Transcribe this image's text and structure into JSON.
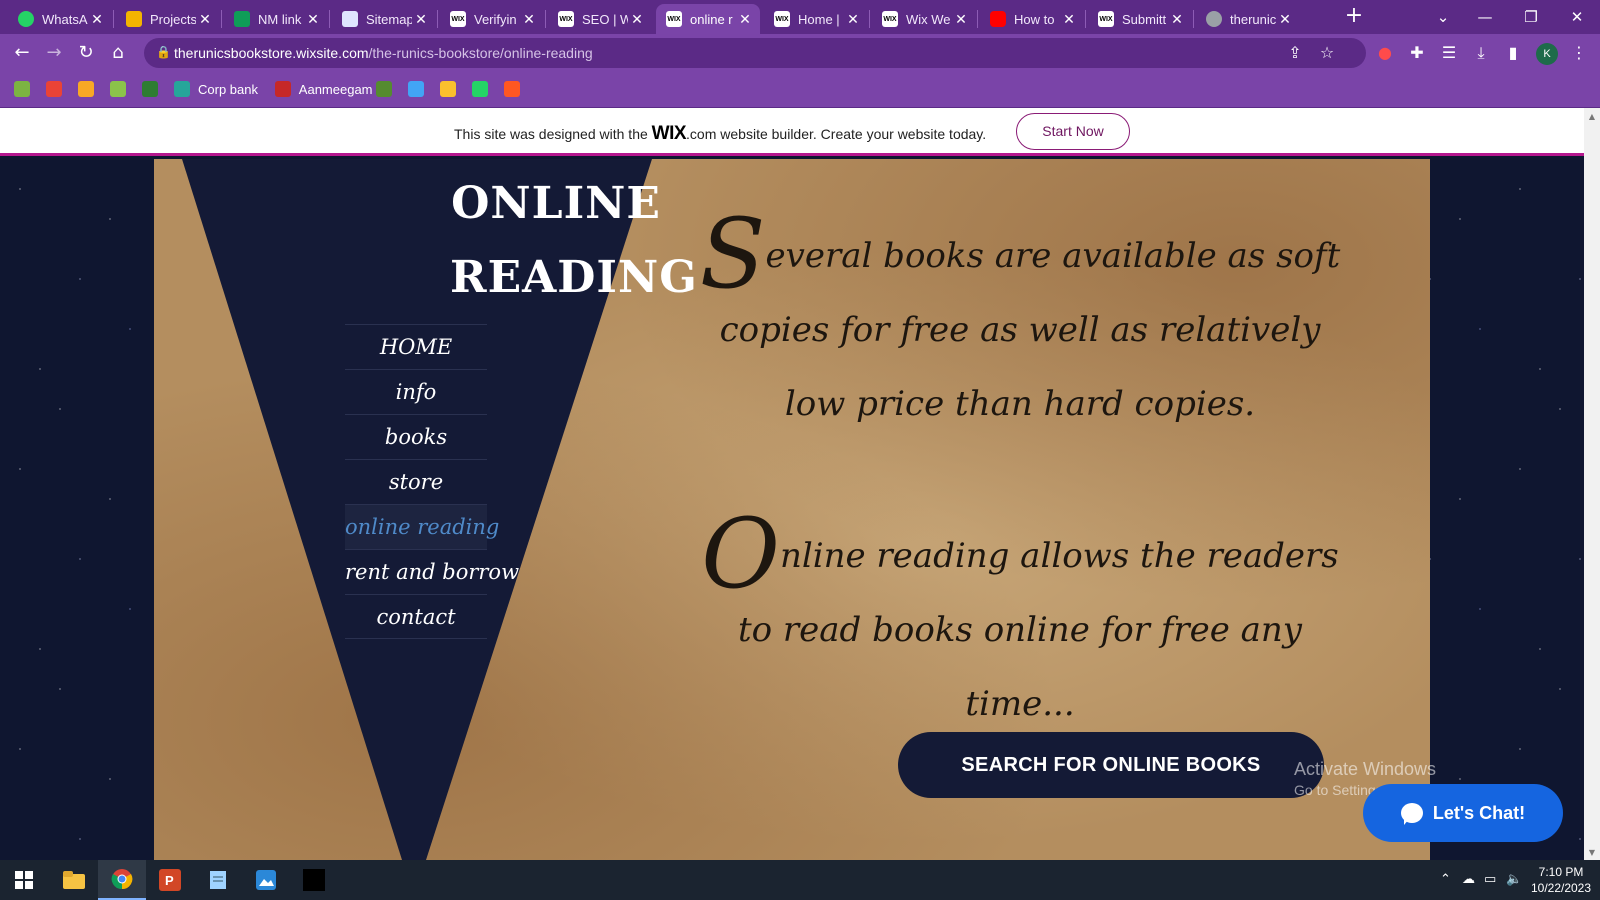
{
  "browser": {
    "tabs": [
      {
        "label": "WhatsA",
        "favicon": "whatsapp-icon",
        "color": "#25d366"
      },
      {
        "label": "Projects",
        "favicon": "google-drive-icon",
        "color": "#f4b400"
      },
      {
        "label": "NM link",
        "favicon": "google-sheets-icon",
        "color": "#0f9d58"
      },
      {
        "label": "Sitemap",
        "favicon": "site-icon",
        "color": "#dfe6ff"
      },
      {
        "label": "Verifyin",
        "favicon": "wix-icon",
        "color": "#ffffff"
      },
      {
        "label": "SEO | W",
        "favicon": "wix-icon",
        "color": "#ffffff"
      },
      {
        "label": "online r",
        "favicon": "wix-icon",
        "color": "#ffffff",
        "active": true
      },
      {
        "label": "Home |",
        "favicon": "wix-icon",
        "color": "#ffffff"
      },
      {
        "label": "Wix We",
        "favicon": "wix-icon",
        "color": "#ffffff"
      },
      {
        "label": "How to",
        "favicon": "youtube-icon",
        "color": "#ff0000"
      },
      {
        "label": "Submitt",
        "favicon": "wix-icon",
        "color": "#ffffff"
      },
      {
        "label": "therunic",
        "favicon": "globe-icon",
        "color": "#9aa0a6"
      }
    ],
    "wix_favicon_text": "WIX",
    "address": {
      "host": "therunicsbookstore.wixsite.com",
      "path": "/the-runics-bookstore/online-reading"
    },
    "profile_initial": "K",
    "bookmarks": [
      {
        "label": "",
        "icon": "bookmark-icon-1",
        "color": "#7cb342"
      },
      {
        "label": "",
        "icon": "gmail-icon",
        "color": "#ea4335"
      },
      {
        "label": "",
        "icon": "crown-icon",
        "color": "#f9a825"
      },
      {
        "label": "",
        "icon": "leaf-icon",
        "color": "#8bc34a"
      },
      {
        "label": "",
        "icon": "tree-icon",
        "color": "#2e7d32"
      },
      {
        "label": "Corp bank",
        "icon": "bank-icon",
        "color": "#26a69a"
      },
      {
        "label": "Aanmeegam",
        "icon": "temple-icon",
        "color": "#c62828"
      },
      {
        "label": "",
        "icon": "moon-icon",
        "color": "#558b2f"
      },
      {
        "label": "",
        "icon": "tools-icon",
        "color": "#42a5f5"
      },
      {
        "label": "",
        "icon": "photo-icon",
        "color": "#fbc02d"
      },
      {
        "label": "",
        "icon": "whatsapp-icon",
        "color": "#25d366"
      },
      {
        "label": "",
        "icon": "k-icon",
        "color": "#ff5722"
      }
    ]
  },
  "wix_banner": {
    "message_before": "This site was designed with the ",
    "brand": "WIX",
    "message_after": ".com website builder. Create your website today.",
    "cta": "Start Now"
  },
  "site": {
    "title_line1": "ONLINE",
    "title_line2": "READING",
    "nav": [
      "HOME",
      "info",
      "books",
      "store",
      "online reading",
      "rent and borrow",
      "contact"
    ],
    "current_nav_index": 4,
    "para1_initial": "S",
    "para1_rest": "everal books are available as soft copies for free as well as relatively low price than hard copies.",
    "para2_initial": "O",
    "para2_rest": "nline reading allows the readers to read books online for free any time...",
    "search_button": "SEARCH FOR ONLINE BOOKS",
    "chat_button": "Let's Chat!"
  },
  "watermark": {
    "line1": "Activate Windows",
    "line2": "Go to Settings to activate Windows."
  },
  "taskbar": {
    "time": "7:10 PM",
    "date": "10/22/2023"
  },
  "colors": {
    "chrome_frame": "#5b2a86",
    "chrome_toolbar": "#7a44a8",
    "wix_accent": "#b5178e",
    "parchment": "#b48e5f",
    "navy": "#141a36",
    "nav_active": "#4f8ac9",
    "chat_blue": "#1565e0"
  }
}
